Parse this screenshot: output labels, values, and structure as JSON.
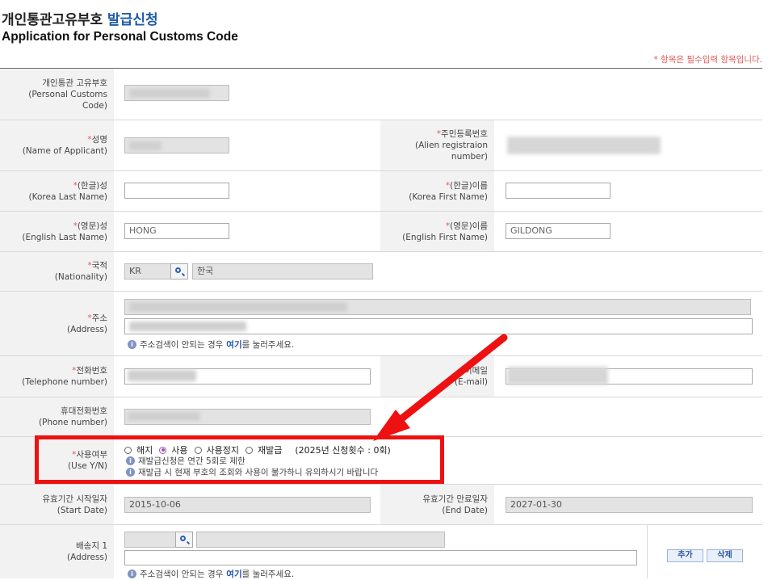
{
  "header": {
    "title_ko": "개인통관고유부호",
    "title_ko_accent": "발급신청",
    "title_en": "Application for Personal Customs Code",
    "required_note": "* 항목은 필수입력 항목입니다."
  },
  "rows": {
    "customs_code": {
      "label_ko": "개인통관 고유부호",
      "label_en": "(Personal Customs Code)"
    },
    "name": {
      "star": "*",
      "label_ko": "성명",
      "label_en": "(Name of Applicant)"
    },
    "alien_reg": {
      "star": "*",
      "label_ko": "주민등록번호",
      "label_en": "(Alien registraion number)"
    },
    "korea_last": {
      "star": "*",
      "label_ko": "(한글)성",
      "label_en": "(Korea Last Name)"
    },
    "korea_first": {
      "star": "*",
      "label_ko": "(한글)이름",
      "label_en": "(Korea First Name)"
    },
    "english_last": {
      "star": "*",
      "label_ko": "(영문)성",
      "label_en": "(English Last Name)",
      "value": "HONG"
    },
    "english_first": {
      "star": "*",
      "label_ko": "(영문)이름",
      "label_en": "(English First Name)",
      "value": "GILDONG"
    },
    "nationality": {
      "star": "*",
      "label_ko": "국적",
      "label_en": "(Nationality)",
      "code": "KR",
      "name": "한국"
    },
    "address": {
      "star": "*",
      "label_ko": "주소",
      "label_en": "(Address)"
    },
    "telephone": {
      "star": "*",
      "label_ko": "전화번호",
      "label_en": "(Telephone number)"
    },
    "email": {
      "star": "*",
      "label_ko": "이메일",
      "label_en": "(E-mail)"
    },
    "phone": {
      "label_ko": "휴대전화번호",
      "label_en": "(Phone number)"
    },
    "use": {
      "star": "*",
      "label_ko": "사용여부",
      "label_en": "(Use Y/N)",
      "options": [
        "해지",
        "사용",
        "사용정지",
        "재발급"
      ],
      "selected": "사용",
      "reissue_count": "(2025년 신청횟수 : 0회)",
      "note1": "재발급신청은 연간 5회로 제한",
      "note2": "재발급 시 현재 부호의 조회와 사용이 불가하니 유의하시기 바랍니다"
    },
    "start_date": {
      "label_ko": "유효기간 시작일자",
      "label_en": "(Start Date)",
      "value": "2015-10-06"
    },
    "end_date": {
      "label_ko": "유효기간 만료일자",
      "label_en": "(End Date)",
      "value": "2027-01-30"
    },
    "delivery": {
      "label_ko": "배송지 1",
      "label_en": "(Address)",
      "add_label": "추가",
      "delete_label": "삭제"
    }
  },
  "address_help": {
    "before": "주소검색이 안되는 경우",
    "link": "여기",
    "after": "를 눌러주세요."
  },
  "colors": {
    "accent": "#1e5aa8",
    "required": "#e05a5a",
    "highlight": "#ee1111",
    "radio_selected": "#9d56b5"
  }
}
